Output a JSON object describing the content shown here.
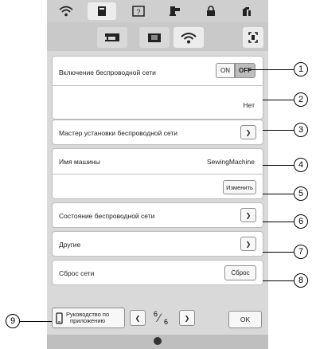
{
  "top_tabs": [
    {
      "icon": "wifi-icon"
    },
    {
      "icon": "page-icon"
    },
    {
      "icon": "help-page-icon"
    },
    {
      "icon": "embroidery-icon"
    },
    {
      "icon": "lock-icon"
    },
    {
      "icon": "settings-icon"
    }
  ],
  "sub_tabs": [
    {
      "icon": "machine-icon"
    },
    {
      "icon": "embroidery-frame-icon"
    },
    {
      "icon": "wifi-icon",
      "active": true
    }
  ],
  "wireless_enable": {
    "label": "Включение беспроводной сети",
    "on": "ON",
    "off": "OFF",
    "selected": "OFF"
  },
  "status_value": "Нет",
  "setup_wizard": {
    "label": "Мастер установки беспроводной сети"
  },
  "machine_name": {
    "label": "Имя машины",
    "value": "SewingMachine",
    "change_label": "Изменить"
  },
  "network_status": {
    "label": "Состояние беспроводной сети"
  },
  "others": {
    "label": "Другие"
  },
  "reset": {
    "label": "Сброс сети",
    "button": "Сброс"
  },
  "bottom": {
    "guide_label_line1": "Руководство по",
    "guide_label_line2": "приложению",
    "page_current": "6",
    "page_total": "6",
    "ok_label": "OK"
  },
  "callouts": [
    "1",
    "2",
    "3",
    "4",
    "5",
    "6",
    "7",
    "8",
    "9"
  ],
  "colors": {
    "screen_bg": "#d9d9d9",
    "panel_bg": "#ffffff",
    "selected_toggle": "#bdbdbd"
  }
}
